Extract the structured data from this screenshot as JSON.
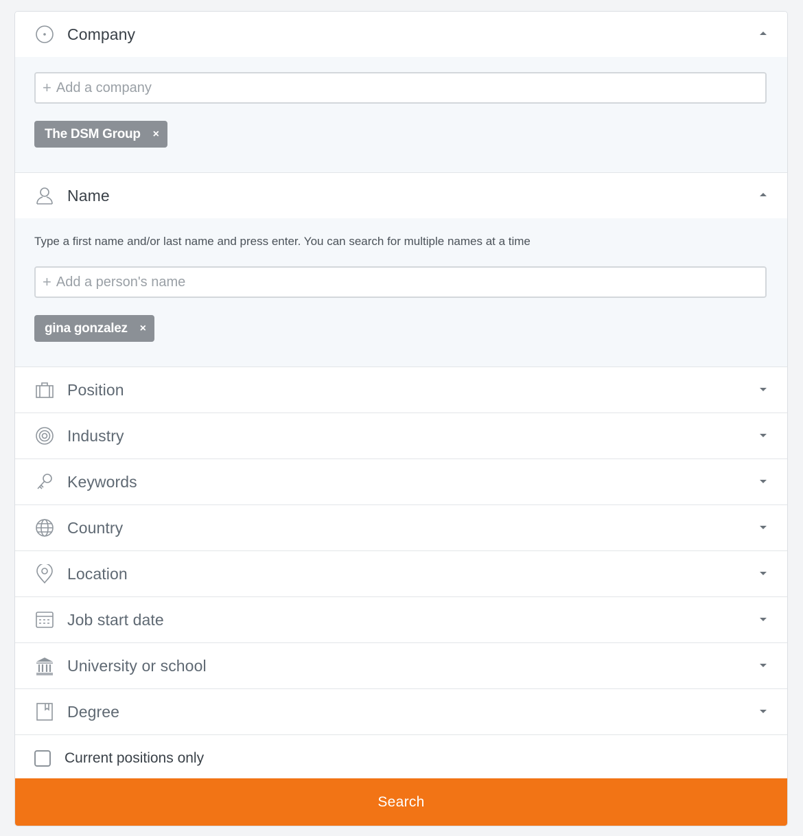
{
  "sections": {
    "company": {
      "title": "Company",
      "placeholder": "Add a company",
      "tags": [
        "The DSM Group"
      ]
    },
    "name": {
      "title": "Name",
      "hint": "Type a first name and/or last name and press enter. You can search for multiple names at a time",
      "placeholder": "Add a person's name",
      "tags": [
        "gina gonzalez"
      ]
    },
    "collapsed": [
      {
        "title": "Position",
        "icon": "briefcase-icon"
      },
      {
        "title": "Industry",
        "icon": "target-icon"
      },
      {
        "title": "Keywords",
        "icon": "key-icon"
      },
      {
        "title": "Country",
        "icon": "globe-icon"
      },
      {
        "title": "Location",
        "icon": "map-pin-icon"
      },
      {
        "title": "Job start date",
        "icon": "calendar-icon"
      },
      {
        "title": "University or school",
        "icon": "institution-icon"
      },
      {
        "title": "Degree",
        "icon": "bookmark-icon"
      }
    ]
  },
  "filters": {
    "current_positions_label": "Current positions only",
    "current_positions_checked": false
  },
  "search": {
    "label": "Search"
  },
  "colors": {
    "accent": "#f27415",
    "tag": "#8b9096",
    "body_bg": "#f5f8fb"
  },
  "remove_glyph": "×"
}
